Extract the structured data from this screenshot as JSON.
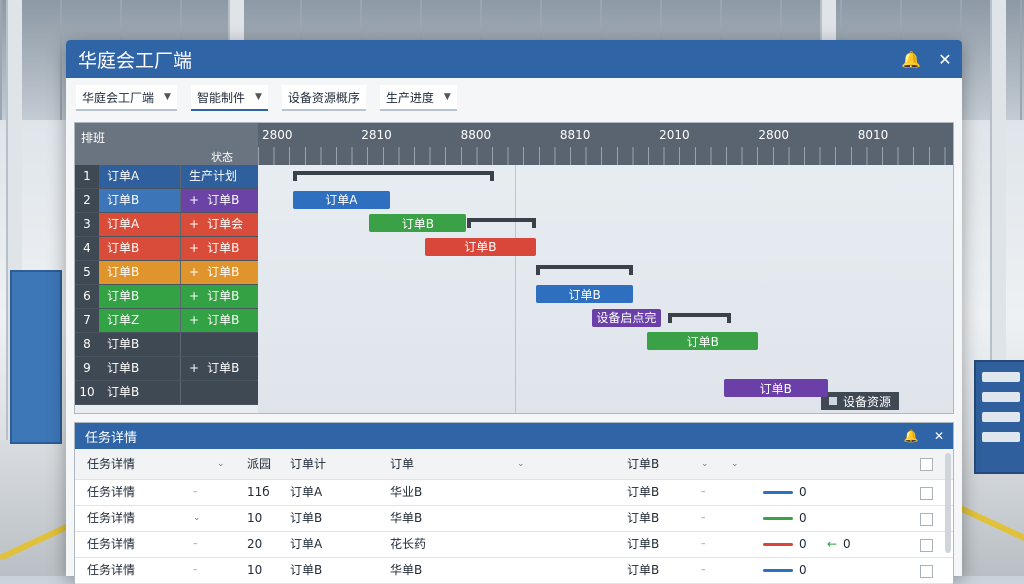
{
  "window": {
    "title": "华庭会工厂端",
    "bell_icon": "bell-icon",
    "close_icon": "close-icon"
  },
  "toolbar": [
    {
      "label": "华庭会工厂端"
    },
    {
      "label": "智能制件"
    },
    {
      "label": "设备资源概序"
    },
    {
      "label": "生产进度"
    }
  ],
  "gantt": {
    "corner_label": "排班",
    "corner_sub": "状态",
    "years": [
      "2800",
      "2810",
      "8800",
      "8810",
      "2010",
      "2800",
      "8010"
    ],
    "rows": [
      {
        "no": "1",
        "a": "订单A",
        "b": "生产计划",
        "a_color": "#2f5f9c",
        "b_color": "#2f5f9c"
      },
      {
        "no": "2",
        "a": "订单B",
        "b": "订单B",
        "a_color": "#3c76b9",
        "b_color": "#6b43a6",
        "b_mark": "+"
      },
      {
        "no": "3",
        "a": "订单A",
        "b": "订单会",
        "a_color": "#d94c3a",
        "b_color": "#d94c3a",
        "b_mark": "+"
      },
      {
        "no": "4",
        "a": "订单B",
        "b": "订单B",
        "a_color": "#d94c3a",
        "b_color": "#d94c3a",
        "b_mark": "+"
      },
      {
        "no": "5",
        "a": "订单B",
        "b": "订单B",
        "a_color": "#e0952c",
        "b_color": "#e0952c",
        "b_mark": "+"
      },
      {
        "no": "6",
        "a": "订单B",
        "b": "订单B",
        "a_color": "#33a244",
        "b_color": "#33a244",
        "b_mark": "+"
      },
      {
        "no": "7",
        "a": "订单Z",
        "b": "订单B",
        "a_color": "#33a244",
        "b_color": "#33a244",
        "b_mark": "+"
      },
      {
        "no": "8",
        "a": "订单B",
        "b": "",
        "a_color": "#3f4954",
        "b_color": "#3f4954"
      },
      {
        "no": "9",
        "a": "订单B",
        "b": "订单B",
        "a_color": "#3f4954",
        "b_color": "#3f4954",
        "b_mark": "+"
      },
      {
        "no": "10",
        "a": "订单B",
        "b": "",
        "a_color": "#3f4954",
        "b_color": "#3f4954"
      }
    ],
    "bars": [
      {
        "label": "订单A",
        "color": "#2f6fbf",
        "row": 2,
        "start": 0.05,
        "end": 0.19
      },
      {
        "label": "订单B",
        "color": "#3aa147",
        "row": 3,
        "start": 0.16,
        "end": 0.3
      },
      {
        "label": "订单B",
        "color": "#d9473a",
        "row": 4,
        "start": 0.24,
        "end": 0.4
      },
      {
        "label": "订单B",
        "color": "#2f6fbf",
        "row": 6,
        "start": 0.4,
        "end": 0.54
      },
      {
        "label": "设备启点完",
        "color": "#6a3fa7",
        "row": 7,
        "start": 0.48,
        "end": 0.58
      },
      {
        "label": "订单B",
        "color": "#3aa147",
        "row": 8,
        "start": 0.56,
        "end": 0.72
      },
      {
        "label": "订单B",
        "color": "#6a3fa7",
        "row": 10,
        "start": 0.67,
        "end": 0.82
      }
    ],
    "summaries": [
      {
        "row": 1,
        "start": 0.05,
        "end": 0.34
      },
      {
        "row": 3,
        "start": 0.3,
        "end": 0.4
      },
      {
        "row": 5,
        "start": 0.4,
        "end": 0.54
      },
      {
        "row": 7,
        "start": 0.59,
        "end": 0.68
      }
    ],
    "chip_label": "设备资源"
  },
  "tasks": {
    "title": "任务详情",
    "header": {
      "c1": "任务详情",
      "c2": "派园",
      "c3": "订单计",
      "c4": "订单",
      "c5": "订单B"
    },
    "rows": [
      {
        "c1": "任务详情",
        "c2": "11б",
        "c3": "订单A",
        "c4": "华业B",
        "c5": "订单B",
        "prog_color": "#2f6fbf",
        "val": "0",
        "extra": ""
      },
      {
        "c1": "任务详情",
        "c2": "10",
        "c3": "订单B",
        "c4": "华单B",
        "c5": "订单B",
        "prog_color": "#3aa147",
        "val": "0",
        "extra": ""
      },
      {
        "c1": "任务详情",
        "c2": "20",
        "c3": "订单A",
        "c4": "花长药",
        "c5": "订单B",
        "prog_color": "#d9473a",
        "val": "0",
        "extra": "0"
      },
      {
        "c1": "任务详情",
        "c2": "10",
        "c3": "订单B",
        "c4": "华单B",
        "c5": "订单B",
        "prog_color": "#2f6fbf",
        "val": "0",
        "extra": ""
      }
    ]
  }
}
